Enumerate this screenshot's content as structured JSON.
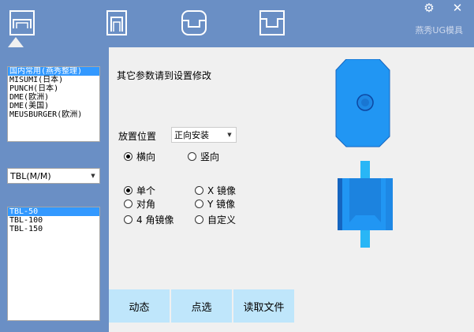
{
  "window": {
    "brand": "燕秀UG模具",
    "gear_icon": "⚙",
    "close_icon": "✕",
    "tabs": [
      {
        "icon": "single-step-icon"
      },
      {
        "icon": "tall-step-icon"
      },
      {
        "icon": "round-step-icon"
      },
      {
        "icon": "double-step-icon"
      }
    ]
  },
  "standards": {
    "items": [
      "国内常用(燕秀整理)",
      "MISUMI(日本)",
      "PUNCH(日本)",
      "DME(欧洲)",
      "DME(美国)",
      "MEUSBURGER(欧洲)"
    ],
    "selected": 0
  },
  "unit_select": {
    "value": "TBL(M/M)"
  },
  "sizes": {
    "items": [
      "TBL-50",
      "TBL-100",
      "TBL-150"
    ],
    "selected": 0
  },
  "hint": "其它参数请到设置修改",
  "placement": {
    "label": "放置位置",
    "value": "正向安装"
  },
  "direction": {
    "horizontal": "横向",
    "vertical": "竖向",
    "selected": "horizontal"
  },
  "mirror": {
    "single": "单个",
    "diagonal": "对角",
    "four": "4 角镜像",
    "x": "X 镜像",
    "y": "Y 镜像",
    "custom": "自定义",
    "selected": "single"
  },
  "buttons": {
    "dynamic": "动态",
    "pick": "点选",
    "read_file": "读取文件"
  },
  "colors": {
    "header": "#6a8fc5",
    "part_blue": "#2196f3",
    "part_dark": "#1565c0",
    "button": "#bfe6fb"
  }
}
